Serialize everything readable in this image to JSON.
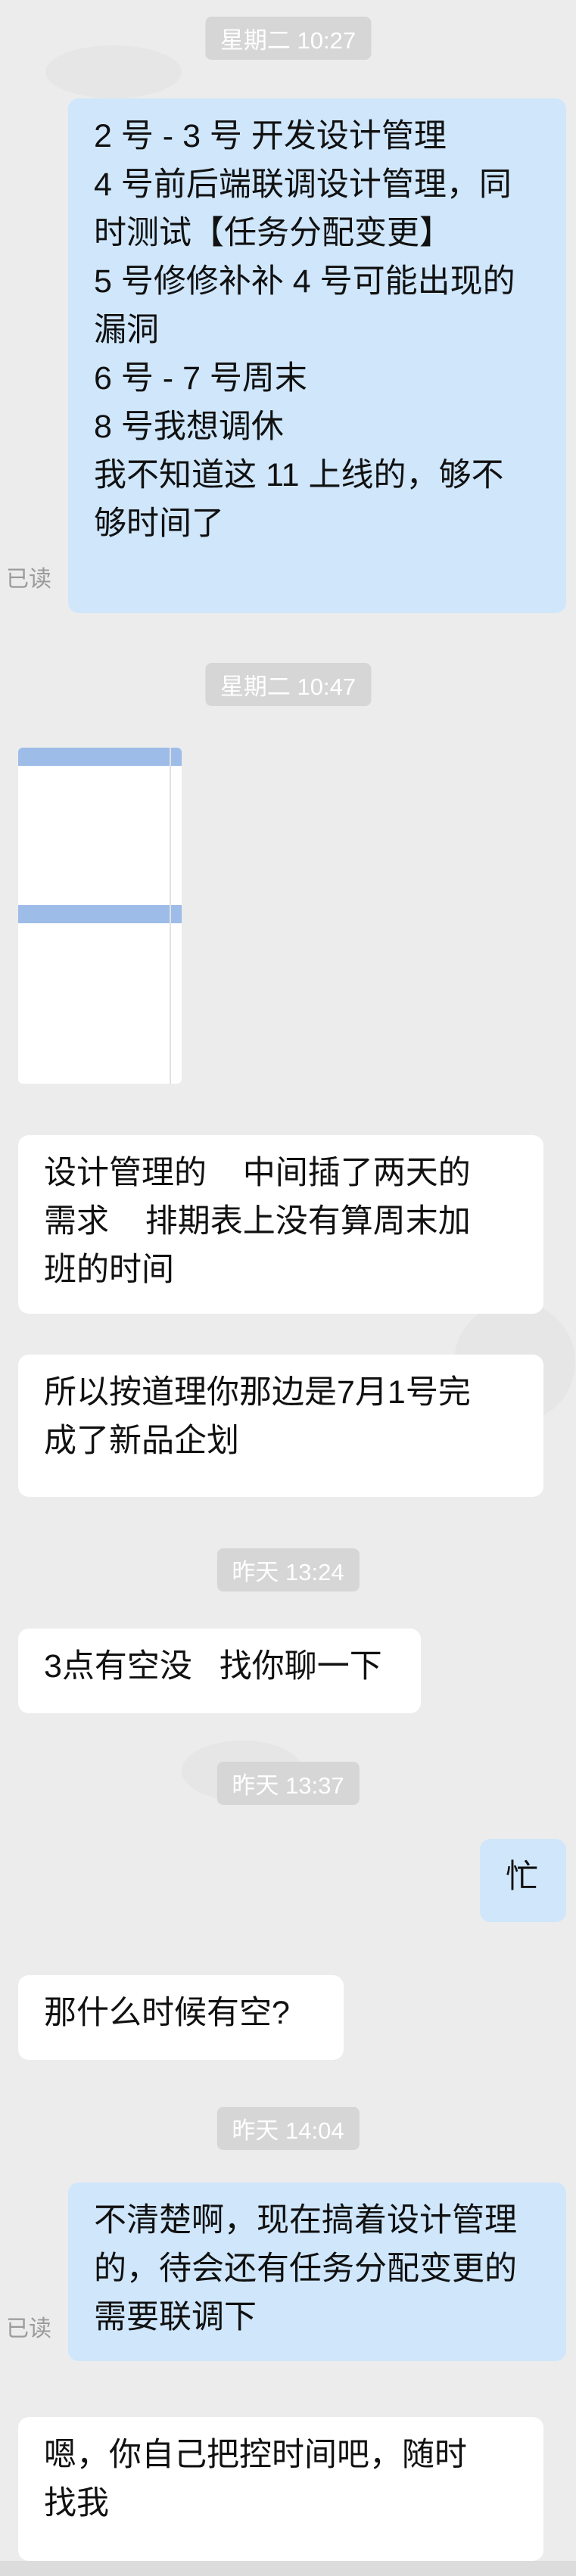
{
  "timestamps": {
    "t1": "星期二 10:27",
    "t2": "星期二 10:47",
    "t3": "昨天 13:24",
    "t4": "昨天 13:37",
    "t5": "昨天 14:04"
  },
  "read_label": "已读",
  "messages": {
    "m1": {
      "lines": [
        "2 号 - 3 号 开发设计管理",
        "4 号前后端联调设计管理，同",
        "时测试【任务分配变更】",
        "5 号修修补补 4 号可能出现的",
        "漏洞",
        "6 号 - 7 号周末",
        "8 号我想调休",
        "",
        "我不知道这 11 上线的，够不",
        "够时间了"
      ]
    },
    "m2": {
      "lines": [
        "设计管理的    中间插了两天的",
        "需求    排期表上没有算周末加",
        "班的时间"
      ]
    },
    "m3": {
      "lines": [
        "所以按道理你那边是7月1号完",
        "成了新品企划"
      ]
    },
    "m4": {
      "lines": [
        "3点有空没   找你聊一下"
      ]
    },
    "m5": {
      "lines": [
        "忙"
      ]
    },
    "m6": {
      "lines": [
        "那什么时候有空?"
      ]
    },
    "m7": {
      "lines": [
        "不清楚啊，现在搞着设计管理",
        "的，待会还有任务分配变更的",
        "需要联调下"
      ]
    },
    "m8": {
      "lines": [
        "嗯，你自己把控时间吧，随时",
        "找我"
      ]
    }
  }
}
